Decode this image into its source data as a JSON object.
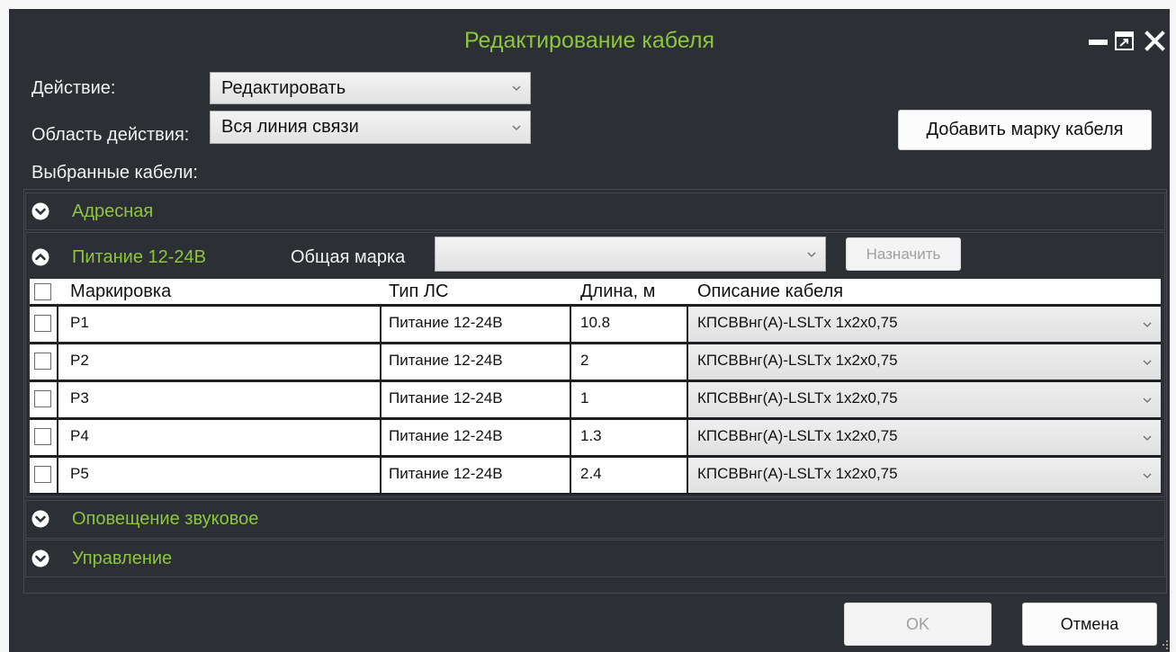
{
  "window": {
    "title": "Редактирование кабеля"
  },
  "icons": {
    "window_minimize": "minimize-icon",
    "window_restore": "restore-icon",
    "window_close": "close-icon",
    "group_collapsed": "chevron-down-circle-icon",
    "group_expanded": "chevron-up-circle-icon",
    "dropdown": "chevron-down-icon"
  },
  "form": {
    "action": {
      "label": "Действие:",
      "value": "Редактировать"
    },
    "scope": {
      "label": "Область действия:",
      "value": "Вся линия связи"
    },
    "add_brand_button": "Добавить марку кабеля",
    "selected_label": "Выбранные кабели:"
  },
  "groups": [
    {
      "name": "Адресная",
      "expanded": false
    },
    {
      "name": "Питание 12-24В",
      "expanded": true,
      "common_brand": {
        "label": "Общая марка",
        "value": ""
      },
      "assign_button": "Назначить",
      "assign_enabled": false,
      "select_all_checked": false,
      "columns": [
        "Маркировка",
        "Тип ЛС",
        "Длина, м",
        "Описание кабеля"
      ],
      "cables": [
        {
          "checked": false,
          "marking": "P1",
          "line_type": "Питание 12-24В",
          "length": "10.8",
          "description": "КПСВВнг(А)-LSLTx 1x2x0,75"
        },
        {
          "checked": false,
          "marking": "P2",
          "line_type": "Питание 12-24В",
          "length": "2",
          "description": "КПСВВнг(А)-LSLTx 1x2x0,75"
        },
        {
          "checked": false,
          "marking": "P3",
          "line_type": "Питание 12-24В",
          "length": "1",
          "description": "КПСВВнг(А)-LSLTx 1x2x0,75"
        },
        {
          "checked": false,
          "marking": "P4",
          "line_type": "Питание 12-24В",
          "length": "1.3",
          "description": "КПСВВнг(А)-LSLTx 1x2x0,75"
        },
        {
          "checked": false,
          "marking": "P5",
          "line_type": "Питание 12-24В",
          "length": "2.4",
          "description": "КПСВВнг(А)-LSLTx 1x2x0,75"
        }
      ]
    },
    {
      "name": "Оповещение звуковое",
      "expanded": false
    },
    {
      "name": "Управление",
      "expanded": false
    }
  ],
  "footer": {
    "ok_button": "OK",
    "ok_enabled": false,
    "cancel_button": "Отмена"
  },
  "colors": {
    "dialog_bg": "#2c2f34",
    "accent_green": "#8cc63f",
    "label_text": "#f2f2f2",
    "disabled_text": "#a0a0a0"
  }
}
